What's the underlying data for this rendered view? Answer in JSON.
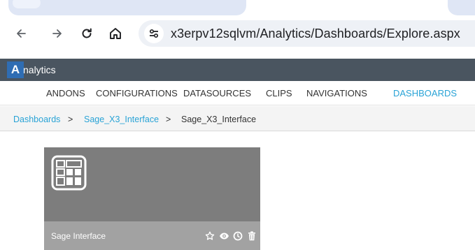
{
  "browser": {
    "url": "x3erpv12sqlvm/Analytics/Dashboards/Explore.aspx",
    "icons": [
      "back-arrow-icon",
      "forward-arrow-icon",
      "reload-icon",
      "home-icon",
      "site-settings-icon"
    ]
  },
  "app": {
    "logo_letter": "A",
    "name": "nalytics",
    "header_color": "#4a5560",
    "logo_color": "#2f6db3"
  },
  "menu": {
    "items": [
      "ANDONS",
      "CONFIGURATIONS",
      "DATASOURCES",
      "CLIPS",
      "NAVIGATIONS",
      "DASHBOARDS"
    ],
    "active": "DASHBOARDS",
    "active_color": "#29a3d6"
  },
  "breadcrumb": {
    "items": [
      "Dashboards",
      "Sage_X3_Interface",
      "Sage_X3_Interface"
    ],
    "separator": ">"
  },
  "tile": {
    "title": "Sage Interface",
    "icon": "dashboard-grid-icon",
    "actions": [
      "star-icon",
      "eye-icon",
      "clock-icon",
      "trash-icon"
    ]
  }
}
